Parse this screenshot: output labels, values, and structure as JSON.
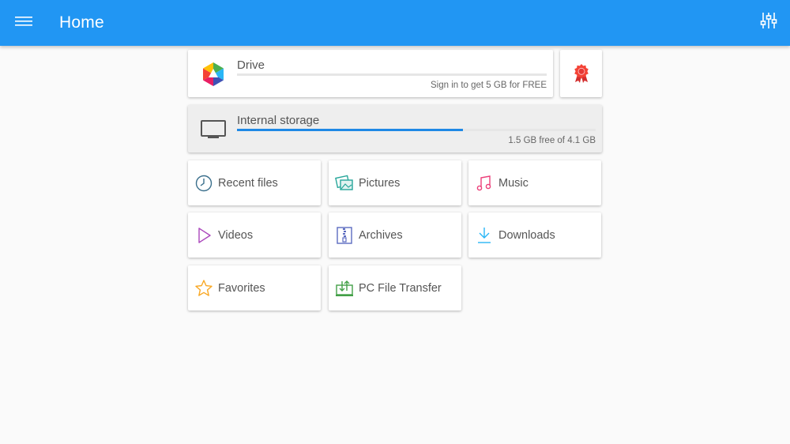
{
  "app_bar": {
    "title": "Home",
    "menu_icon": "hamburger-menu-icon",
    "settings_icon": "sliders-settings-icon",
    "color": "#2196f3"
  },
  "drive": {
    "name": "Drive",
    "subtitle": "Sign in to get 5 GB for FREE",
    "icon": "drive-hexagon-logo-icon",
    "badge_icon": "award-ribbon-icon"
  },
  "internal_storage": {
    "name": "Internal storage",
    "subtitle": "1.5 GB free of 4.1 GB",
    "icon": "monitor-storage-icon",
    "used_fraction": 0.63,
    "bar_color": "#1e88e5"
  },
  "categories": [
    {
      "label": "Recent files",
      "icon": "clock-icon",
      "color": "#3a6f8c"
    },
    {
      "label": "Pictures",
      "icon": "pictures-icon",
      "color": "#26a69a"
    },
    {
      "label": "Music",
      "icon": "music-note-icon",
      "color": "#ec407a"
    },
    {
      "label": "Videos",
      "icon": "play-icon",
      "color": "#ab47bc"
    },
    {
      "label": "Archives",
      "icon": "archive-zip-icon",
      "color": "#5c6bc0"
    },
    {
      "label": "Downloads",
      "icon": "download-icon",
      "color": "#29b6f6"
    },
    {
      "label": "Favorites",
      "icon": "star-icon",
      "color": "#f9a825"
    },
    {
      "label": "PC File Transfer",
      "icon": "pc-file-transfer-icon",
      "color": "#43a047"
    }
  ]
}
